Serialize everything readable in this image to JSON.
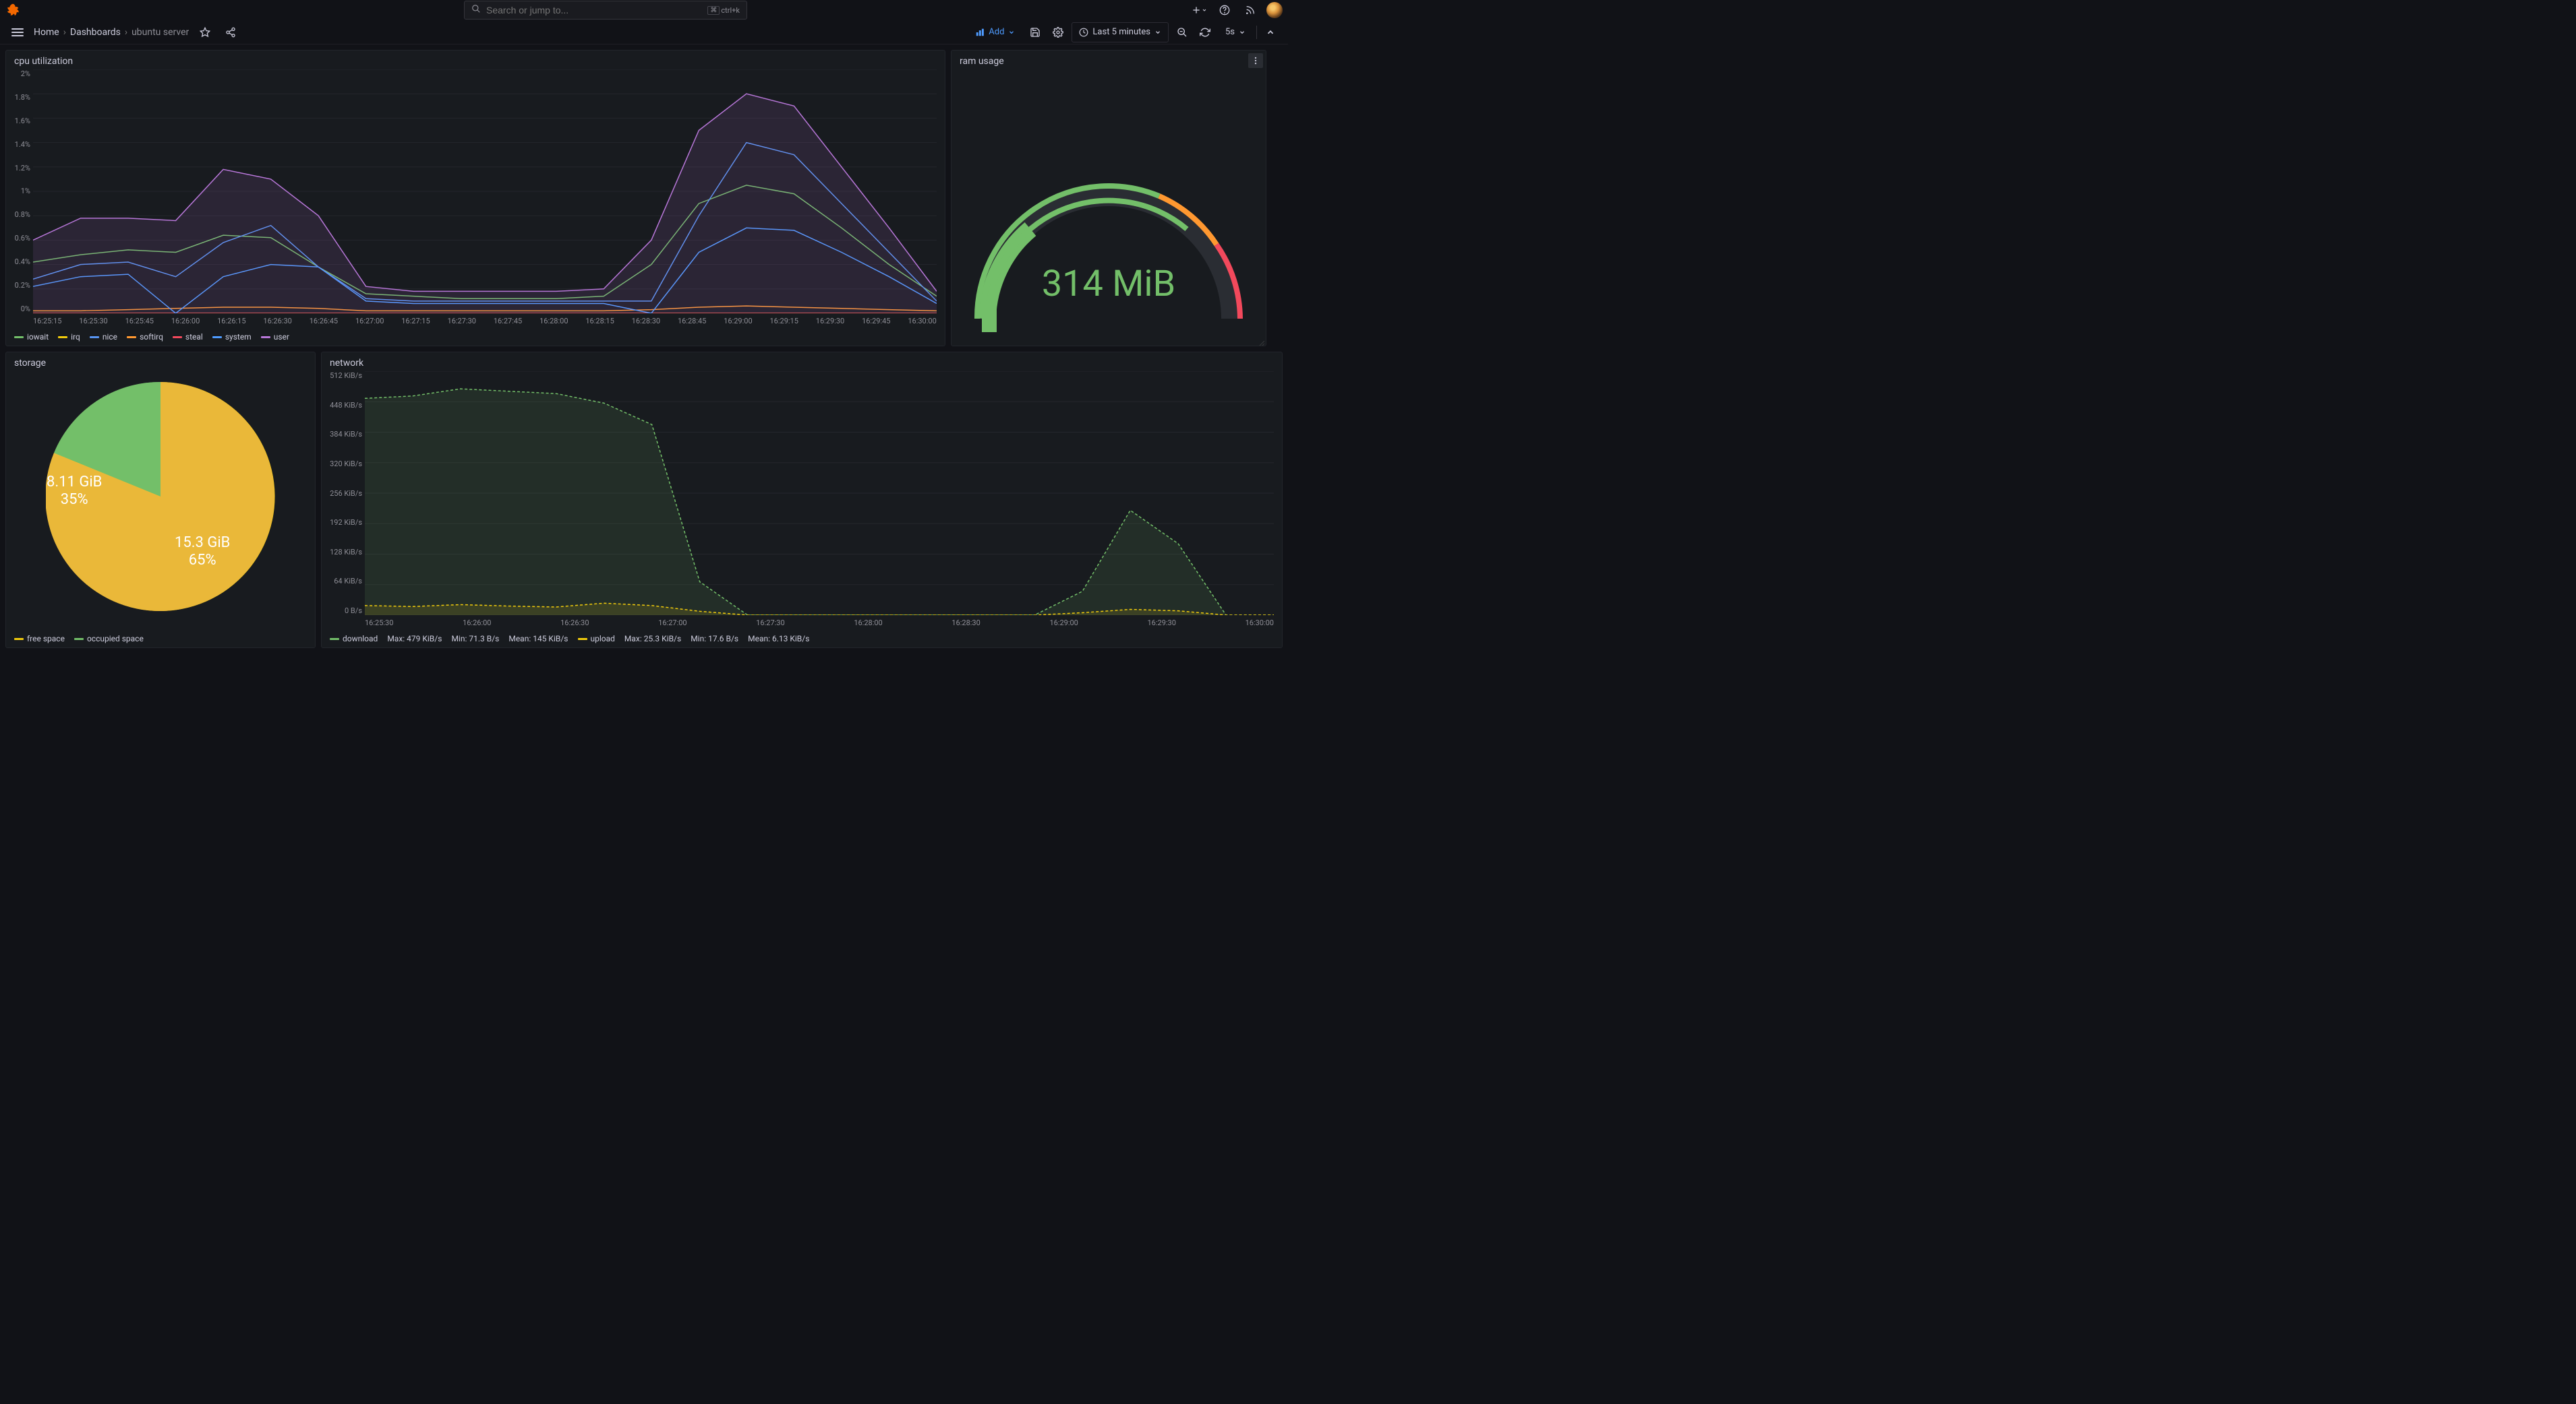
{
  "topbar": {
    "search_placeholder": "Search or jump to...",
    "kbd_hint": "ctrl+k"
  },
  "breadcrumb": {
    "home": "Home",
    "dashboards": "Dashboards",
    "current": "ubuntu server"
  },
  "toolbar": {
    "add_label": "Add",
    "time_range": "Last 5 minutes",
    "refresh_interval": "5s"
  },
  "panels": {
    "cpu": {
      "title": "cpu utilization"
    },
    "ram": {
      "title": "ram usage",
      "value": "314 MiB"
    },
    "storage": {
      "title": "storage",
      "free_label": "8.11 GiB",
      "free_pct": "35%",
      "occupied_label": "15.3 GiB",
      "occupied_pct": "65%",
      "legend_free": "free space",
      "legend_occupied": "occupied space"
    },
    "network": {
      "title": "network",
      "legend_download": "download",
      "dl_max": "Max: 479 KiB/s",
      "dl_min": "Min: 71.3 B/s",
      "dl_mean": "Mean: 145 KiB/s",
      "legend_upload": "upload",
      "ul_max": "Max: 25.3 KiB/s",
      "ul_min": "Min: 17.6 B/s",
      "ul_mean": "Mean: 6.13 KiB/s"
    }
  },
  "chart_data": [
    {
      "type": "line",
      "title": "cpu utilization",
      "xlabel": "",
      "ylabel": "%",
      "ylim": [
        0,
        2.0
      ],
      "x_ticks": [
        "16:25:15",
        "16:25:30",
        "16:25:45",
        "16:26:00",
        "16:26:15",
        "16:26:30",
        "16:26:45",
        "16:27:00",
        "16:27:15",
        "16:27:30",
        "16:27:45",
        "16:28:00",
        "16:28:15",
        "16:28:30",
        "16:28:45",
        "16:29:00",
        "16:29:15",
        "16:29:30",
        "16:29:45",
        "16:30:00"
      ],
      "y_ticks": [
        "0%",
        "0.2%",
        "0.4%",
        "0.6%",
        "0.8%",
        "1%",
        "1.2%",
        "1.4%",
        "1.6%",
        "1.8%",
        "2%"
      ],
      "series": [
        {
          "name": "iowait",
          "color": "#73bf69",
          "values": [
            0.42,
            0.48,
            0.52,
            0.5,
            0.64,
            0.62,
            0.38,
            0.16,
            0.14,
            0.12,
            0.12,
            0.12,
            0.14,
            0.4,
            0.9,
            1.05,
            0.98,
            0.7,
            0.4,
            0.14
          ]
        },
        {
          "name": "irq",
          "color": "#f2cc0c",
          "values": [
            0,
            0,
            0,
            0,
            0,
            0,
            0,
            0,
            0,
            0,
            0,
            0,
            0,
            0,
            0,
            0,
            0,
            0,
            0,
            0
          ]
        },
        {
          "name": "nice",
          "color": "#5794f2",
          "values": [
            0.28,
            0.4,
            0.42,
            0.3,
            0.58,
            0.72,
            0.38,
            0.12,
            0.1,
            0.1,
            0.1,
            0.1,
            0.1,
            0.1,
            0.8,
            1.4,
            1.3,
            0.9,
            0.5,
            0.1
          ]
        },
        {
          "name": "softirq",
          "color": "#ff9830",
          "values": [
            0.02,
            0.02,
            0.03,
            0.04,
            0.05,
            0.05,
            0.04,
            0.02,
            0.02,
            0.02,
            0.02,
            0.02,
            0.02,
            0.03,
            0.05,
            0.06,
            0.05,
            0.04,
            0.03,
            0.02
          ]
        },
        {
          "name": "steal",
          "color": "#f2495c",
          "values": [
            0,
            0,
            0,
            0,
            0,
            0,
            0,
            0,
            0,
            0,
            0,
            0,
            0,
            0,
            0,
            0,
            0,
            0,
            0,
            0
          ]
        },
        {
          "name": "system",
          "color": "#4e9bff",
          "values": [
            0.22,
            0.3,
            0.32,
            0.0,
            0.3,
            0.4,
            0.38,
            0.1,
            0.08,
            0.08,
            0.08,
            0.08,
            0.08,
            0.0,
            0.5,
            0.7,
            0.68,
            0.5,
            0.3,
            0.08
          ]
        },
        {
          "name": "user",
          "color": "#b877d9",
          "values": [
            0.6,
            0.78,
            0.78,
            0.76,
            1.18,
            1.1,
            0.8,
            0.22,
            0.18,
            0.18,
            0.18,
            0.18,
            0.2,
            0.6,
            1.5,
            1.8,
            1.7,
            1.2,
            0.7,
            0.18
          ]
        }
      ]
    },
    {
      "type": "gauge",
      "title": "ram usage",
      "value": 314,
      "unit": "MiB",
      "range": [
        0,
        1000
      ],
      "thresholds": [
        {
          "color": "#73bf69",
          "from": 0
        },
        {
          "color": "#ff9830",
          "from": 700
        },
        {
          "color": "#f2495c",
          "from": 850
        }
      ]
    },
    {
      "type": "pie",
      "title": "storage",
      "slices": [
        {
          "name": "free space",
          "value": 8.11,
          "unit": "GiB",
          "pct": 35,
          "color": "#f2cc0c"
        },
        {
          "name": "occupied space",
          "value": 15.3,
          "unit": "GiB",
          "pct": 65,
          "color": "#73bf69"
        }
      ]
    },
    {
      "type": "area",
      "title": "network",
      "xlabel": "",
      "ylabel": "",
      "ylim": [
        0,
        524288
      ],
      "x_ticks": [
        "16:25:30",
        "16:26:00",
        "16:26:30",
        "16:27:00",
        "16:27:30",
        "16:28:00",
        "16:28:30",
        "16:29:00",
        "16:29:30",
        "16:30:00"
      ],
      "y_ticks": [
        "0 B/s",
        "64 KiB/s",
        "128 KiB/s",
        "192 KiB/s",
        "256 KiB/s",
        "320 KiB/s",
        "384 KiB/s",
        "448 KiB/s",
        "512 KiB/s"
      ],
      "series": [
        {
          "name": "download",
          "color": "#73bf69",
          "stats": {
            "max": "479 KiB/s",
            "min": "71.3 B/s",
            "mean": "145 KiB/s"
          },
          "values_kib": [
            455,
            460,
            475,
            470,
            465,
            445,
            400,
            70,
            0.07,
            0.07,
            0.07,
            0.07,
            0.07,
            0.07,
            0.07,
            50,
            220,
            150,
            0.07,
            0.07
          ]
        },
        {
          "name": "upload",
          "color": "#f2cc0c",
          "stats": {
            "max": "25.3 KiB/s",
            "min": "17.6 B/s",
            "mean": "6.13 KiB/s"
          },
          "values_kib": [
            20,
            18,
            22,
            19,
            17,
            25,
            20,
            8,
            0.02,
            0.02,
            0.02,
            0.02,
            0.02,
            0.02,
            0.02,
            5,
            12,
            9,
            0.02,
            0.02
          ]
        }
      ]
    }
  ]
}
